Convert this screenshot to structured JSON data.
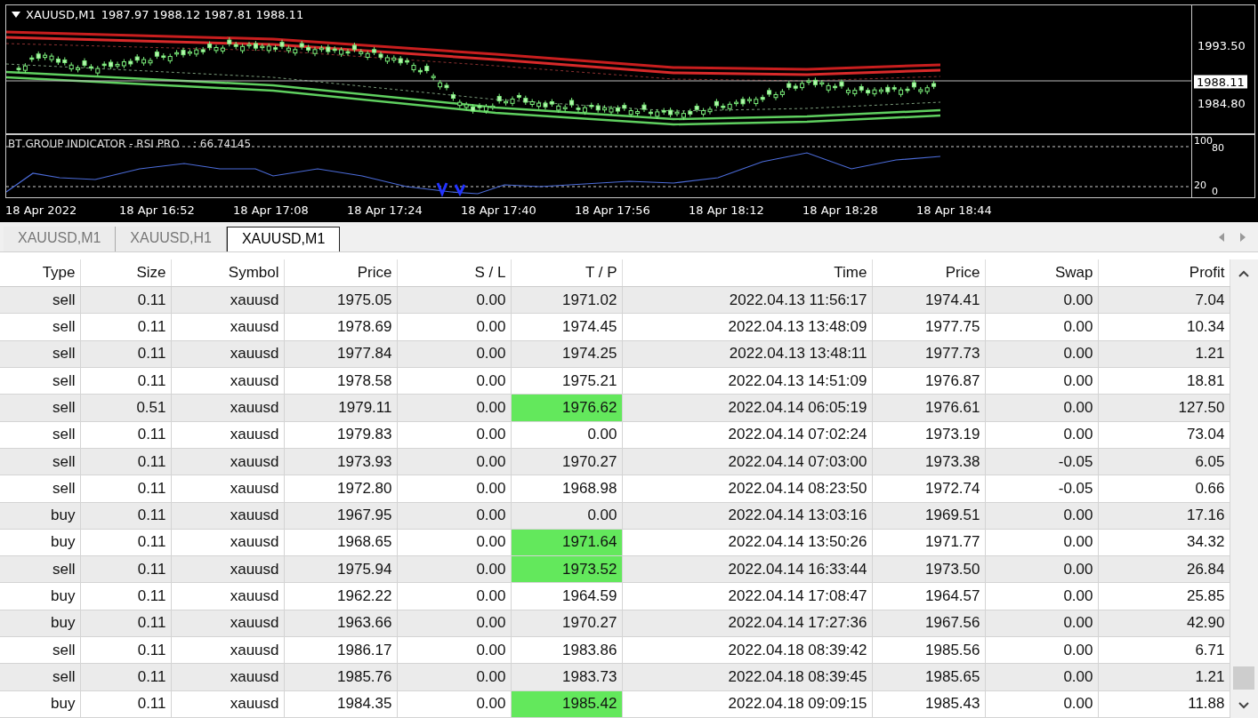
{
  "chart": {
    "symbol_header": "XAUUSD,M1",
    "ohlc": "1987.97 1988.12 1987.81 1988.11",
    "price_labels": [
      "1993.50",
      "1984.80"
    ],
    "current_price": "1988.11",
    "indicator_label": "BT GROUP INDICATOR - RSI PRO    : 66.74145",
    "indicator_levels": [
      "100",
      "80",
      "20",
      "0"
    ],
    "time_labels": [
      "18 Apr 2022",
      "18 Apr 16:52",
      "18 Apr 17:08",
      "18 Apr 17:24",
      "18 Apr 17:40",
      "18 Apr 17:56",
      "18 Apr 18:12",
      "18 Apr 18:28",
      "18 Apr 18:44"
    ]
  },
  "tabs": [
    {
      "label": "XAUUSD,M1",
      "selected": false
    },
    {
      "label": "XAUUSD,H1",
      "selected": false
    },
    {
      "label": "XAUUSD,M1",
      "selected": true
    }
  ],
  "table": {
    "columns": [
      "Type",
      "Size",
      "Symbol",
      "Price",
      "S / L",
      "T / P",
      "Time",
      "Price",
      "Swap",
      "Profit"
    ],
    "rows": [
      {
        "cells": [
          "sell",
          "0.11",
          "xauusd",
          "1975.05",
          "0.00",
          "1971.02",
          "2022.04.13 11:56:17",
          "1974.41",
          "0.00",
          "7.04"
        ],
        "tp_hit": false
      },
      {
        "cells": [
          "sell",
          "0.11",
          "xauusd",
          "1978.69",
          "0.00",
          "1974.45",
          "2022.04.13 13:48:09",
          "1977.75",
          "0.00",
          "10.34"
        ],
        "tp_hit": false
      },
      {
        "cells": [
          "sell",
          "0.11",
          "xauusd",
          "1977.84",
          "0.00",
          "1974.25",
          "2022.04.13 13:48:11",
          "1977.73",
          "0.00",
          "1.21"
        ],
        "tp_hit": false
      },
      {
        "cells": [
          "sell",
          "0.11",
          "xauusd",
          "1978.58",
          "0.00",
          "1975.21",
          "2022.04.13 14:51:09",
          "1976.87",
          "0.00",
          "18.81"
        ],
        "tp_hit": false
      },
      {
        "cells": [
          "sell",
          "0.51",
          "xauusd",
          "1979.11",
          "0.00",
          "1976.62",
          "2022.04.14 06:05:19",
          "1976.61",
          "0.00",
          "127.50"
        ],
        "tp_hit": true
      },
      {
        "cells": [
          "sell",
          "0.11",
          "xauusd",
          "1979.83",
          "0.00",
          "0.00",
          "2022.04.14 07:02:24",
          "1973.19",
          "0.00",
          "73.04"
        ],
        "tp_hit": false
      },
      {
        "cells": [
          "sell",
          "0.11",
          "xauusd",
          "1973.93",
          "0.00",
          "1970.27",
          "2022.04.14 07:03:00",
          "1973.38",
          "-0.05",
          "6.05"
        ],
        "tp_hit": false
      },
      {
        "cells": [
          "sell",
          "0.11",
          "xauusd",
          "1972.80",
          "0.00",
          "1968.98",
          "2022.04.14 08:23:50",
          "1972.74",
          "-0.05",
          "0.66"
        ],
        "tp_hit": false
      },
      {
        "cells": [
          "buy",
          "0.11",
          "xauusd",
          "1967.95",
          "0.00",
          "0.00",
          "2022.04.14 13:03:16",
          "1969.51",
          "0.00",
          "17.16"
        ],
        "tp_hit": false
      },
      {
        "cells": [
          "buy",
          "0.11",
          "xauusd",
          "1968.65",
          "0.00",
          "1971.64",
          "2022.04.14 13:50:26",
          "1971.77",
          "0.00",
          "34.32"
        ],
        "tp_hit": true
      },
      {
        "cells": [
          "sell",
          "0.11",
          "xauusd",
          "1975.94",
          "0.00",
          "1973.52",
          "2022.04.14 16:33:44",
          "1973.50",
          "0.00",
          "26.84"
        ],
        "tp_hit": true
      },
      {
        "cells": [
          "buy",
          "0.11",
          "xauusd",
          "1962.22",
          "0.00",
          "1964.59",
          "2022.04.14 17:08:47",
          "1964.57",
          "0.00",
          "25.85"
        ],
        "tp_hit": false
      },
      {
        "cells": [
          "buy",
          "0.11",
          "xauusd",
          "1963.66",
          "0.00",
          "1970.27",
          "2022.04.14 17:27:36",
          "1967.56",
          "0.00",
          "42.90"
        ],
        "tp_hit": false
      },
      {
        "cells": [
          "sell",
          "0.11",
          "xauusd",
          "1986.17",
          "0.00",
          "1983.86",
          "2022.04.18 08:39:42",
          "1985.56",
          "0.00",
          "6.71"
        ],
        "tp_hit": false
      },
      {
        "cells": [
          "sell",
          "0.11",
          "xauusd",
          "1985.76",
          "0.00",
          "1983.73",
          "2022.04.18 08:39:45",
          "1985.65",
          "0.00",
          "1.21"
        ],
        "tp_hit": false
      },
      {
        "cells": [
          "buy",
          "0.11",
          "xauusd",
          "1984.35",
          "0.00",
          "1985.42",
          "2022.04.18 09:09:15",
          "1985.43",
          "0.00",
          "11.88"
        ],
        "tp_hit": true
      }
    ]
  }
}
